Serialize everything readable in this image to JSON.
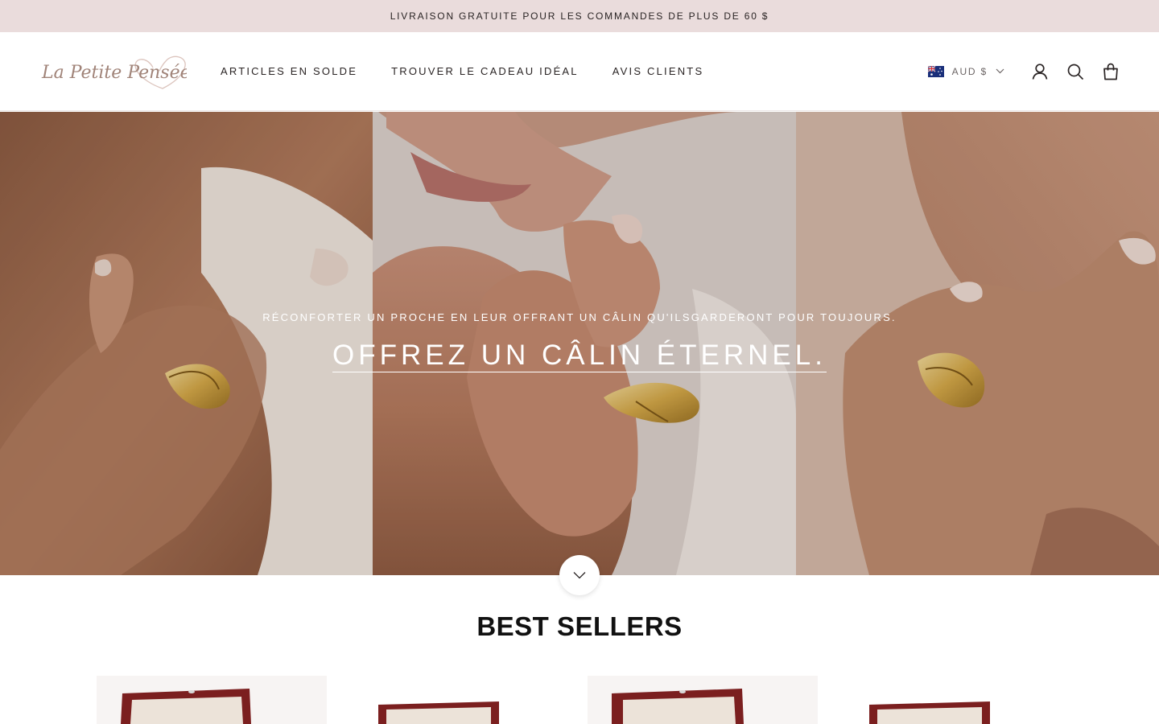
{
  "announcement": {
    "text": "LIVRAISON GRATUITE POUR LES COMMANDES DE PLUS DE 60 $"
  },
  "header": {
    "logo_text": "La Petite Pensée",
    "nav": [
      {
        "label": "ARTICLES EN SOLDE"
      },
      {
        "label": "TROUVER LE CADEAU IDÉAL"
      },
      {
        "label": "AVIS CLIENTS"
      }
    ],
    "currency": {
      "label": "AUD $",
      "flag": "australia-flag"
    },
    "icons": [
      "account-icon",
      "search-icon",
      "cart-icon"
    ]
  },
  "hero": {
    "subtitle": "RÉCONFORTER UN PROCHE EN LEUR OFFRANT UN CÂLIN QU'ILSGARDERONT POUR TOUJOURS.",
    "title": "OFFREZ UN CÂLIN ÉTERNEL."
  },
  "best_sellers": {
    "title": "BEST SELLERS"
  },
  "colors": {
    "announcement_bg": "#eadcdc",
    "text": "#2a2424",
    "logo": "#a08378"
  }
}
